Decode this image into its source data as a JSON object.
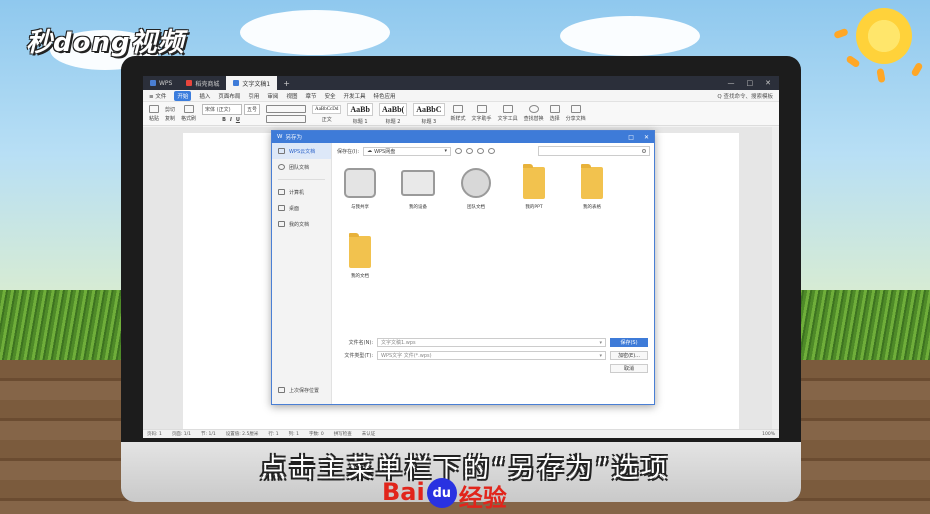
{
  "video": {
    "logo": "秒dong视频",
    "caption": "点击主菜单栏下的“另存为”选项",
    "watermark_bai": "Bai",
    "watermark_du": "du",
    "watermark_jy": "经验"
  },
  "app": {
    "tabs": [
      {
        "label": "WPS",
        "color": "#4a7fd4"
      },
      {
        "label": "稻壳商城",
        "color": "#e8453c"
      },
      {
        "label": "文字文稿1",
        "color": "#3e7bd8"
      }
    ],
    "tab_add": "+",
    "window_buttons": [
      "—",
      "□",
      "✕"
    ]
  },
  "menu": {
    "file": "≡ 文件",
    "items": [
      "开始",
      "插入",
      "页面布局",
      "引用",
      "审阅",
      "视图",
      "章节",
      "安全",
      "开发工具",
      "特色应用"
    ],
    "active_index": 0,
    "search": "Q 查找命令、搜索模板"
  },
  "ribbon": {
    "paste": "粘贴",
    "cut": "剪切",
    "copy": "复制",
    "format_painter": "格式刷",
    "font": "宋体 (正文)",
    "size": "五号",
    "styles": [
      "AaBbCcDd",
      "AaBb",
      "AaBb(",
      "AaBbC"
    ],
    "style_labels": [
      "正文",
      "标题 1",
      "标题 2",
      "标题 3"
    ],
    "new_style": "新样式",
    "text_assistant": "文字助手",
    "text_tools": "文字工具",
    "find_replace": "查找替换",
    "select": "选择",
    "share": "分享文档"
  },
  "statusbar": {
    "page_count": "页码: 1",
    "page": "页面: 1/1",
    "section": "节: 1/1",
    "position": "设置值: 2.5厘米",
    "row": "行: 1",
    "col": "列: 1",
    "words": "字数: 0",
    "spell": "拼写检查",
    "proof": "未认证",
    "zoom": "100%"
  },
  "dialog": {
    "title": "另存为",
    "sidebar": [
      {
        "label": "WPS云文档",
        "active": true
      },
      {
        "label": "团队文档",
        "active": false
      },
      {
        "label": "计算机",
        "active": false
      },
      {
        "label": "桌面",
        "active": false
      },
      {
        "label": "我的文档",
        "active": false
      }
    ],
    "last_location": "上次保存位置",
    "save_in_label": "保存在(I):",
    "save_in_value": "WPS网盘",
    "search_placeholder": "",
    "items": [
      {
        "label": "与我共享",
        "icon": "share-folder"
      },
      {
        "label": "我的设备",
        "icon": "device"
      },
      {
        "label": "团队文档",
        "icon": "team"
      },
      {
        "label": "我的PPT",
        "icon": "folder"
      },
      {
        "label": "我的表格",
        "icon": "folder"
      },
      {
        "label": "我的文档",
        "icon": "folder"
      }
    ],
    "filename_label": "文件名(N):",
    "filename_value": "文字文稿1.wps",
    "filetype_label": "文件类型(T):",
    "filetype_value": "WPS文字 文件(*.wps)",
    "save_button": "保存(S)",
    "encrypt_button": "加密(E)...",
    "cancel_button": "取消"
  }
}
